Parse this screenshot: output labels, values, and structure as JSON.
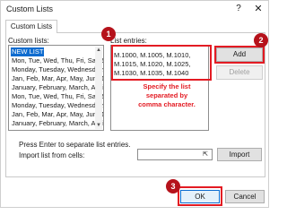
{
  "window": {
    "title": "Custom Lists",
    "help_label": "?",
    "close_label": "✕"
  },
  "tab": {
    "label": "Custom Lists"
  },
  "custom_lists": {
    "label": "Custom lists:",
    "items": [
      "NEW LIST",
      "Mon, Tue, Wed, Thu, Fri, Sat, Sun",
      "Monday, Tuesday, Wednesday, Th",
      "Jan, Feb, Mar, Apr, May, Jun, Jul,",
      "January, February, March, April, M",
      "Mon, Tue, Wed, Thu, Fri, Sat, Sun",
      "Monday, Tuesday, Wednesday, Th",
      "Jan, Feb, Mar, Apr, May, Jun, Jul,",
      "January, February, March, April, M"
    ],
    "selected_index": 0
  },
  "list_entries": {
    "label": "List entries:",
    "lines": [
      "M.1000, M.1005, M.1010,",
      "M.1015, M.1020, M.1025,",
      "M.1030, M.1035, M.1040"
    ],
    "annotation_lines": [
      "Specify the list",
      "separated by",
      "comma character."
    ]
  },
  "buttons": {
    "add": "Add",
    "delete": "Delete",
    "import": "Import",
    "ok": "OK",
    "cancel": "Cancel"
  },
  "footer": {
    "press_enter": "Press Enter to separate list entries.",
    "import_label": "Import list from cells:",
    "import_value": "",
    "range_icon": "⇱"
  },
  "badges": {
    "one": "1",
    "two": "2",
    "three": "3"
  },
  "colors": {
    "highlight_red": "#e31b23",
    "badge_red": "#b5121b",
    "selection_blue": "#0f6ccf"
  },
  "icons": {
    "range_select": "range-select-icon"
  }
}
